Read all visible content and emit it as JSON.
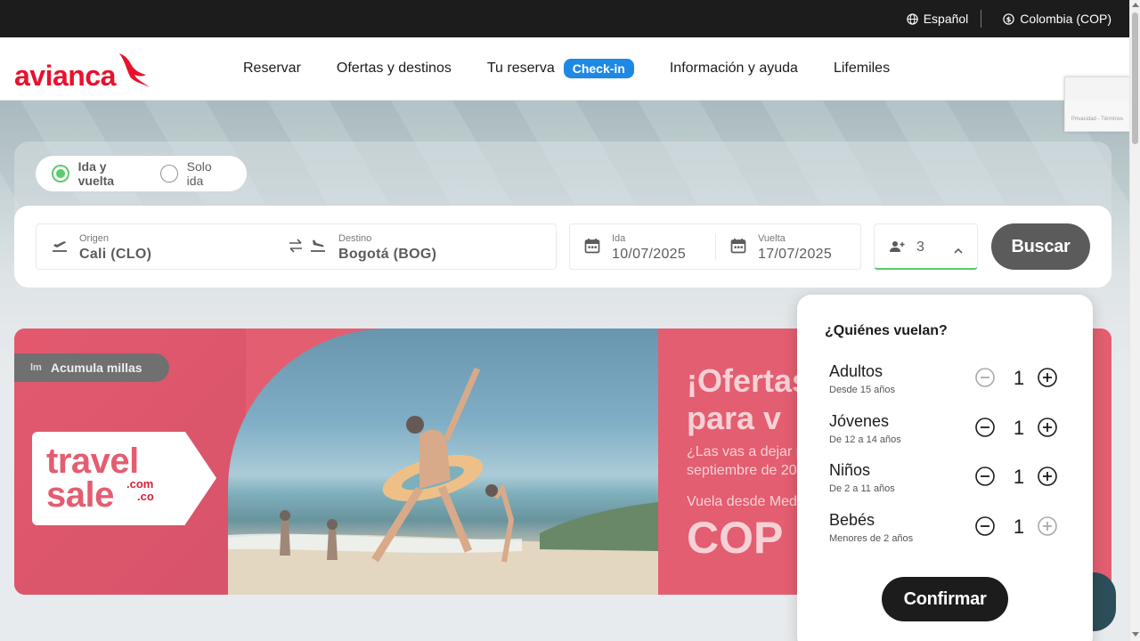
{
  "topbar": {
    "language": "Español",
    "region": "Colombia (COP)"
  },
  "brand": {
    "name": "avianca",
    "color": "#e8112d"
  },
  "nav": {
    "items": [
      "Reservar",
      "Ofertas y destinos",
      "Tu reserva",
      "Información y ayuda",
      "Lifemiles"
    ],
    "checkin_badge": "Check-in"
  },
  "recaptcha": {
    "text": "Privacidad - Términos"
  },
  "trip_type": {
    "options": [
      "Ida y vuelta",
      "Solo ida"
    ],
    "selected": "Ida y vuelta"
  },
  "search": {
    "origin": {
      "label": "Origen",
      "value": "Cali  (CLO)"
    },
    "destination": {
      "label": "Destino",
      "value": "Bogotá  (BOG)"
    },
    "departure": {
      "label": "Ida",
      "value": "10/07/2025"
    },
    "return": {
      "label": "Vuelta",
      "value": "17/07/2025"
    },
    "passengers": "3",
    "button": "Buscar"
  },
  "banner": {
    "badge": "Acumula millas",
    "badge_logo": "lm",
    "tag_line1": "travel",
    "tag_line2": "sale",
    "tag_domain1": ".com",
    "tag_domain2": ".co",
    "title_line1": "¡Ofertas",
    "title_line2": "para v",
    "subtitle_line1": "¿Las vas a dejar p",
    "subtitle_line2": "septiembre de 20",
    "fly_from": "Vuela desde Med",
    "price": "COP"
  },
  "passenger_popup": {
    "title": "¿Quiénes vuelan?",
    "rows": [
      {
        "name": "Adultos",
        "desc": "Desde 15 años",
        "count": "1",
        "minus_enabled": false,
        "plus_enabled": true
      },
      {
        "name": "Jóvenes",
        "desc": "De 12 a 14 años",
        "count": "1",
        "minus_enabled": true,
        "plus_enabled": true
      },
      {
        "name": "Niños",
        "desc": "De 2 a 11 años",
        "count": "1",
        "minus_enabled": true,
        "plus_enabled": true
      },
      {
        "name": "Bebés",
        "desc": "Menores de 2 años",
        "count": "1",
        "minus_enabled": true,
        "plus_enabled": false
      }
    ],
    "confirm": "Confirmar"
  },
  "colors": {
    "accent_green": "#1bb934",
    "checkin_blue": "#1e88e5",
    "dark": "#1c1c1c",
    "banner_red": "#d8203a"
  }
}
